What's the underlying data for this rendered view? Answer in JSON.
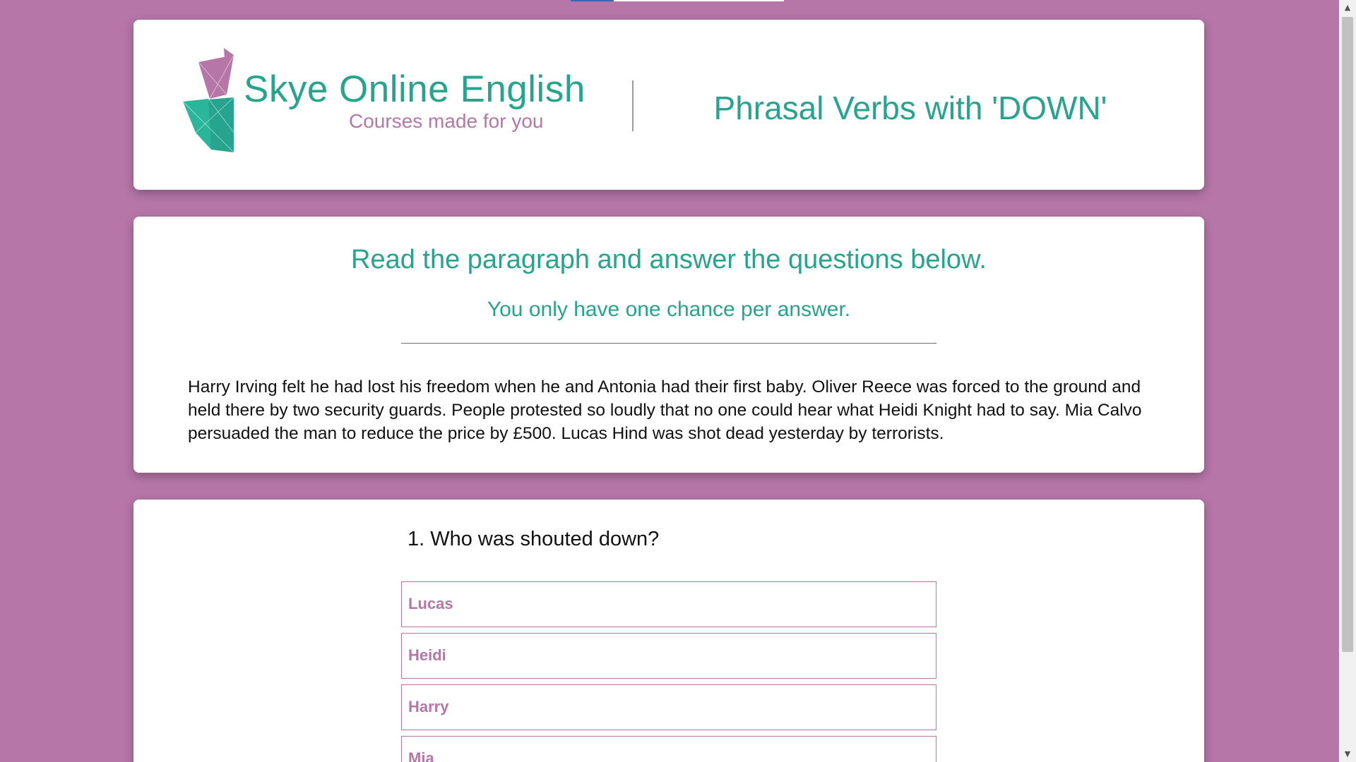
{
  "brand": {
    "name": "Skye Online English",
    "tagline": "Courses made for you",
    "colors": {
      "primary": "#26a48d",
      "accent": "#b676a8"
    }
  },
  "header": {
    "title": "Phrasal Verbs with 'DOWN'"
  },
  "intro": {
    "title": "Read the paragraph and answer the questions below.",
    "subtitle": "You only have one chance per answer.",
    "paragraph": "Harry Irving felt he had lost his freedom when he and Antonia had their first baby. Oliver Reece was forced to the ground and held there by two security guards. People protested so loudly that no one could hear what Heidi Knight had to say. Mia Calvo persuaded the man to reduce the price by £500. Lucas Hind was shot dead yesterday by terrorists."
  },
  "question": {
    "text": "1. Who was shouted down?",
    "options": [
      "Lucas",
      "Heidi",
      "Harry",
      "Mia"
    ]
  },
  "scrollbar": {
    "up_icon": "▲",
    "down_icon": "▼"
  }
}
